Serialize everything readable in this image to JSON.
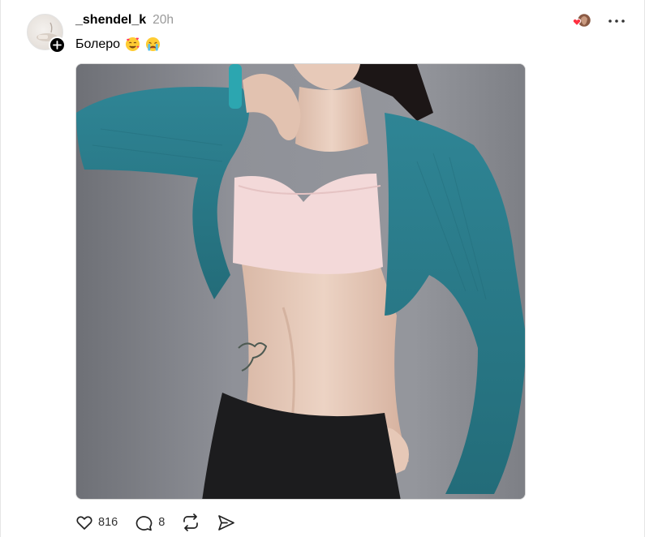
{
  "post": {
    "username": "_shendel_k",
    "time": "20h",
    "caption": "Болеро",
    "caption_emojis": [
      "smiling-face-with-hearts-emoji",
      "crying-face-emoji"
    ]
  },
  "actions": {
    "likes": "816",
    "replies": "8"
  },
  "icons": {
    "like": "heart-outline-icon",
    "reply": "speech-bubble-icon",
    "repost": "repost-arrows-icon",
    "share": "send-arrow-icon",
    "more": "more-dots-icon"
  },
  "colors": {
    "cardigan": "#2b7b89",
    "top": "#f4d8d8",
    "background_wall": "#8d8f96",
    "heart": "#ff3040"
  }
}
